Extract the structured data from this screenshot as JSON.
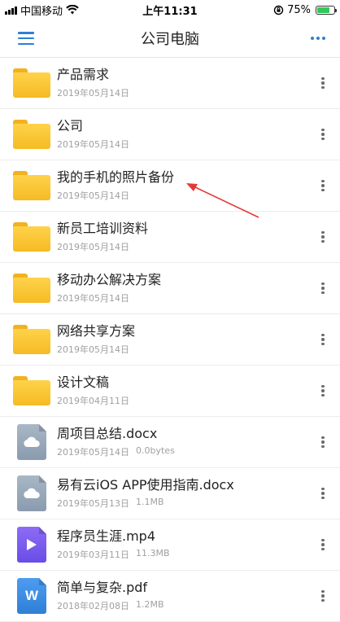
{
  "status_bar": {
    "carrier": "中国移动",
    "time": "上午11:31",
    "battery_percent": "75%",
    "battery_level": 0.75
  },
  "nav": {
    "title": "公司电脑",
    "menu_icon": "hamburger-icon",
    "more_icon": "more-dots-icon"
  },
  "files": [
    {
      "name": "产品需求",
      "date": "2019年05月14日",
      "size": "",
      "type": "folder"
    },
    {
      "name": "公司",
      "date": "2019年05月14日",
      "size": "",
      "type": "folder"
    },
    {
      "name": "我的手机的照片备份",
      "date": "2019年05月14日",
      "size": "",
      "type": "folder"
    },
    {
      "name": "新员工培训资料",
      "date": "2019年05月14日",
      "size": "",
      "type": "folder"
    },
    {
      "name": "移动办公解决方案",
      "date": "2019年05月14日",
      "size": "",
      "type": "folder"
    },
    {
      "name": "网络共享方案",
      "date": "2019年05月14日",
      "size": "",
      "type": "folder"
    },
    {
      "name": "设计文稿",
      "date": "2019年04月11日",
      "size": "",
      "type": "folder"
    },
    {
      "name": "周项目总结.docx",
      "date": "2019年05月14日",
      "size": "0.0bytes",
      "type": "cloud-doc"
    },
    {
      "name": "易有云iOS APP使用指南.docx",
      "date": "2019年05月13日",
      "size": "1.1MB",
      "type": "cloud-doc"
    },
    {
      "name": "程序员生涯.mp4",
      "date": "2019年03月11日",
      "size": "11.3MB",
      "type": "video"
    },
    {
      "name": "简单与复杂.pdf",
      "date": "2018年02月08日",
      "size": "1.2MB",
      "type": "word-doc"
    }
  ],
  "colors": {
    "accent": "#2f7fd6",
    "folder": "#f5bb24",
    "cloud_doc": "#8e9fb0",
    "video": "#7a5af0",
    "word_doc": "#3b8ce8",
    "annotation_arrow": "#e53935"
  }
}
